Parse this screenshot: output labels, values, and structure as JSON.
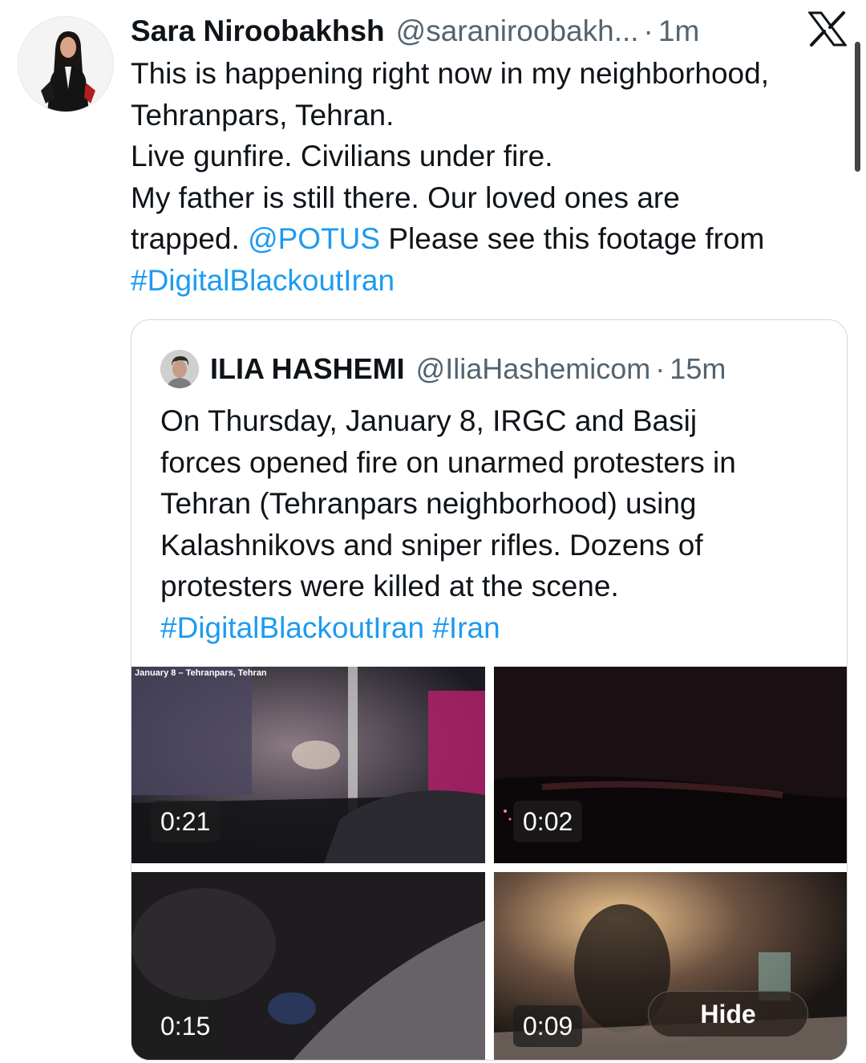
{
  "post": {
    "author_name": "Sara Niroobakhsh",
    "author_handle": "@saraniroobakh...",
    "separator": "·",
    "time": "1m",
    "text_lines": [
      "This is happening right now in my neighborhood,",
      "Tehranpars, Tehran.",
      "Live gunfire. Civilians under fire.",
      "My father is still there. Our loved ones are"
    ],
    "line5_prefix": "trapped. ",
    "mention": "@POTUS",
    "line5_suffix": " Please see this footage from",
    "hashtag": "#DigitalBlackoutIran"
  },
  "quote": {
    "author_name": "ILIA HASHEMI",
    "author_handle": "@IliaHashemicom",
    "separator": "·",
    "time": "15m",
    "text_lines": [
      "On Thursday, January 8, IRGC and Basij",
      "forces opened fire on unarmed protesters in",
      "Tehran (Tehranpars neighborhood) using",
      "Kalashnikovs and sniper rifles. Dozens of",
      "protesters were killed at the scene."
    ],
    "hashtag1": "#DigitalBlackoutIran",
    "hashtag2": "#Iran"
  },
  "media": {
    "video_caption": "January 8 – Tehranpars, Tehran",
    "durations": [
      "0:21",
      "0:02",
      "0:15",
      "0:09"
    ],
    "hide_label": "Hide"
  },
  "icons": {
    "app_logo": "x-logo-icon",
    "avatar": "avatar-image",
    "quote_avatar": "quote-avatar-image"
  },
  "colors": {
    "link": "#1d9bf0",
    "secondary_text": "#536471",
    "border": "#cfd9de"
  }
}
